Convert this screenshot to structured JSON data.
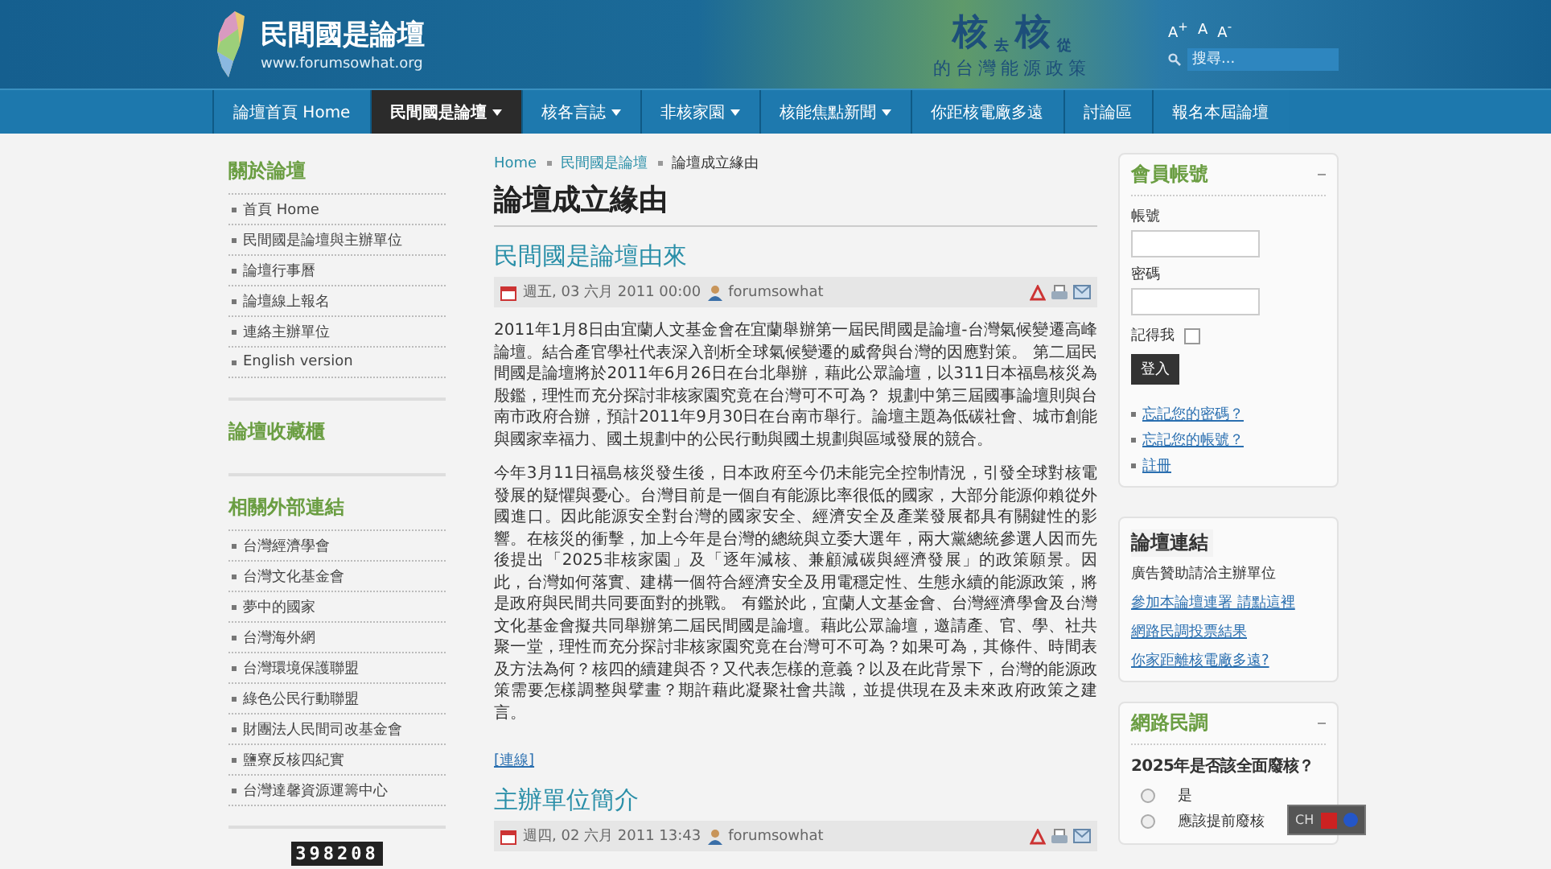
{
  "header": {
    "site_name": "民間國是論壇",
    "site_url": "www.forumsowhat.org",
    "banner_words": [
      "核",
      "去",
      "核",
      "從"
    ],
    "banner_subtitle": "的台灣能源政策",
    "font_sizes": [
      "A$^{+}$",
      "A",
      "A$^{-}$"
    ],
    "search": {
      "placeholder": "搜尋..."
    }
  },
  "nav": [
    {
      "label": "論壇首頁 Home",
      "dropdown": false,
      "selected": false
    },
    {
      "label": "民間國是論壇",
      "dropdown": true,
      "selected": true
    },
    {
      "label": "核各言誌",
      "dropdown": true,
      "selected": false
    },
    {
      "label": "非核家園",
      "dropdown": true,
      "selected": false
    },
    {
      "label": "核能焦點新聞",
      "dropdown": true,
      "selected": false
    },
    {
      "label": "你距核電廠多遠",
      "dropdown": false,
      "selected": false
    },
    {
      "label": "討論區",
      "dropdown": false,
      "selected": false
    },
    {
      "label": "報名本屆論壇",
      "dropdown": false,
      "selected": false
    }
  ],
  "sidebar": {
    "sections": [
      {
        "title": "關於論壇",
        "items": [
          "首頁 Home",
          "民間國是論壇與主辦單位",
          "論壇行事曆",
          "論壇線上報名",
          "連絡主辦單位",
          "English version"
        ]
      },
      {
        "title": "論壇收藏櫃"
      },
      {
        "title": "相關外部連結",
        "items": [
          "台灣經濟學會",
          "台灣文化基金會",
          "夢中的國家",
          "台灣海外網",
          "台灣環境保護聯盟",
          "綠色公民行動聯盟",
          "財團法人民間司改基金會",
          "鹽寮反核四紀實",
          "台灣達馨資源運籌中心"
        ]
      }
    ],
    "counter": "398208"
  },
  "breadcrumb": [
    "Home",
    "民間國是論壇",
    "論壇成立緣由"
  ],
  "page_title": "論壇成立緣由",
  "articles": [
    {
      "title": "民間國是論壇由來",
      "date": "週五, 03 六月 2011 00:00",
      "author": "forumsowhat",
      "paragraphs": [
        "2011年1月8日由宜蘭人文基金會在宜蘭舉辦第一屆民間國是論壇-台灣氣候變遷高峰論壇。結合產官學社代表深入剖析全球氣候變遷的威脅與台灣的因應對策。 第二屆民間國是論壇將於2011年6月26日在台北舉辦，藉此公眾論壇，以311日本福島核災為殷鑑，理性而充分探討非核家園究竟在台灣可不可為？ 規劃中第三屆國事論壇則與台南市政府合辦，預計2011年9月30日在台南市舉行。論壇主題為低碳社會、城市創能與國家幸福力、國土規劃中的公民行動與國土規劃與區域發展的競合。",
        "今年3月11日福島核災發生後，日本政府至今仍未能完全控制情況，引發全球對核電發展的疑懼與憂心。台灣目前是一個自有能源比率很低的國家，大部分能源仰賴從外國進口。因此能源安全對台灣的國家安全、經濟安全及產業發展都具有關鍵性的影響。在核災的衝擊，加上今年是台灣的總統與立委大選年，兩大黨總統參選人因而先後提出「2025非核家園」及「逐年減核、兼顧減碳與經濟發展」的政策願景。因此，台灣如何落實、建構一個符合經濟安全及用電穩定性、生態永續的能源政策，將是政府與民間共同要面對的挑戰。 有鑑於此，宜蘭人文基金會、台灣經濟學會及台灣文化基金會擬共同舉辦第二屆民間國是論壇。藉此公眾論壇，邀請產、官、學、社共聚一堂，理性而充分探討非核家園究竟在台灣可不可為？如果可為，其條件、時間表及方法為何？核四的續建與否？又代表怎樣的意義？以及在此背景下，台灣的能源政策需要怎樣調整與擘畫？期許藉此凝聚社會共識，並提供現在及未來政府政策之建言。"
      ],
      "link": "[連線]"
    },
    {
      "title": "主辦單位簡介",
      "date": "週四, 02 六月 2011 13:43",
      "author": "forumsowhat"
    }
  ],
  "login": {
    "title": "會員帳號",
    "username_label": "帳號",
    "password_label": "密碼",
    "remember_label": "記得我",
    "remember": false,
    "submit": "登入",
    "links": [
      "忘記您的密碼？",
      "忘記您的帳號？",
      "註冊"
    ]
  },
  "forum_links": {
    "title": "論壇連結",
    "note": "廣告贊助請洽主辦單位",
    "links": [
      "參加本論壇連署 請點這裡",
      "網路民調投票結果",
      "你家距離核電廠多遠?"
    ]
  },
  "poll": {
    "title": "網路民調",
    "question": "2025年是否該全面廢核？",
    "options": [
      {
        "label": "是",
        "selected": false
      },
      {
        "label": "應該提前廢核",
        "selected": false
      }
    ]
  },
  "ime_bar": {
    "label": "CH"
  }
}
